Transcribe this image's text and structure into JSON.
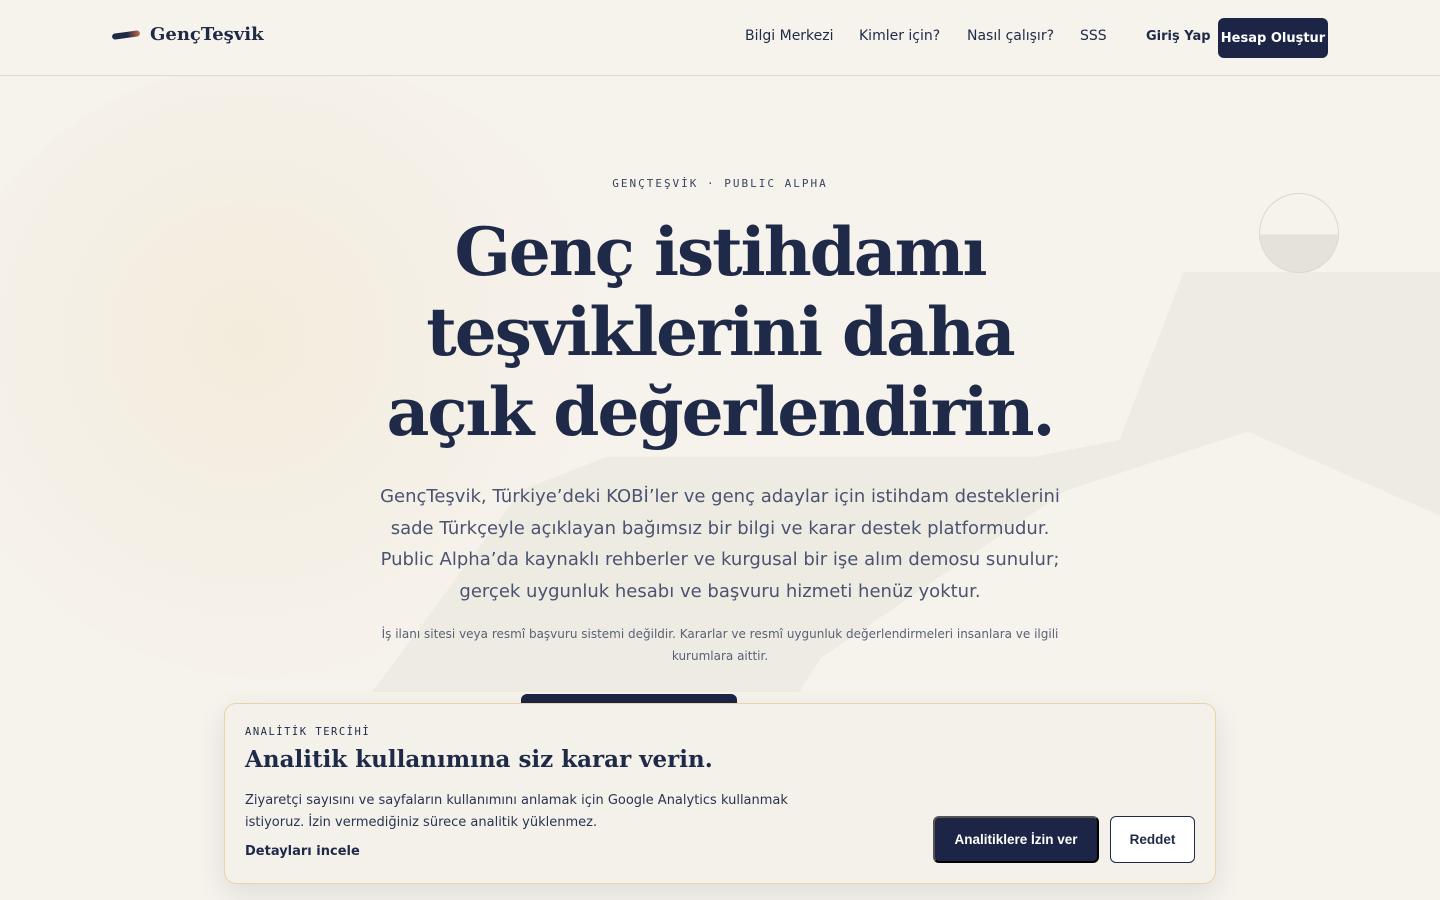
{
  "brand": {
    "name": "GençTeşvik",
    "logo_icon": "pen-stroke-icon"
  },
  "nav": {
    "items": [
      "Bilgi Merkezi",
      "Kimler için?",
      "Nasıl çalışır?",
      "SSS"
    ],
    "login_label": "Giriş Yap",
    "signup_label": "Hesap Oluştur"
  },
  "hero": {
    "eyebrow": "GENÇTEŞVİK · PUBLIC ALPHA",
    "title_lines": [
      "Genç istihdamı",
      "teşviklerini daha",
      "açık değerlendirin."
    ],
    "description": "GençTeşvik, Türkiye’deki KOBİ’ler ve genç adaylar için istihdam desteklerini sade Türkçeyle açıklayan bağımsız bir bilgi ve karar destek platformudur. Public Alpha’da kaynaklı rehberler ve kurgusal bir işe alım demosu sunulur; gerçek uygunluk hesabı ve başvuru hizmeti henüz yoktur.",
    "note": "İş ilanı sitesi veya resmî başvuru sistemi değildir. Kararlar ve resmî uygunluk değerlendirmeleri insanlara ve ilgili kurumlara aittir."
  },
  "consent": {
    "eyebrow": "ANALİTİK TERCİHİ",
    "title": "Analitik kullanımına siz karar verin.",
    "description": "Ziyaretçi sayısını ve sayfaların kullanımını anlamak için Google Analytics kullanmak istiyoruz. İzin vermediğiniz sürece analitik yüklenmez.",
    "details_link": "Detayları incele",
    "accept_label": "Analitiklere İzin ver",
    "reject_label": "Reddet"
  },
  "colors": {
    "background": "#f6f2ec",
    "navy": "#1c2545",
    "text": "#1f2a48",
    "banner_border": "#e8d4a6",
    "accent": "#c06a4a"
  }
}
